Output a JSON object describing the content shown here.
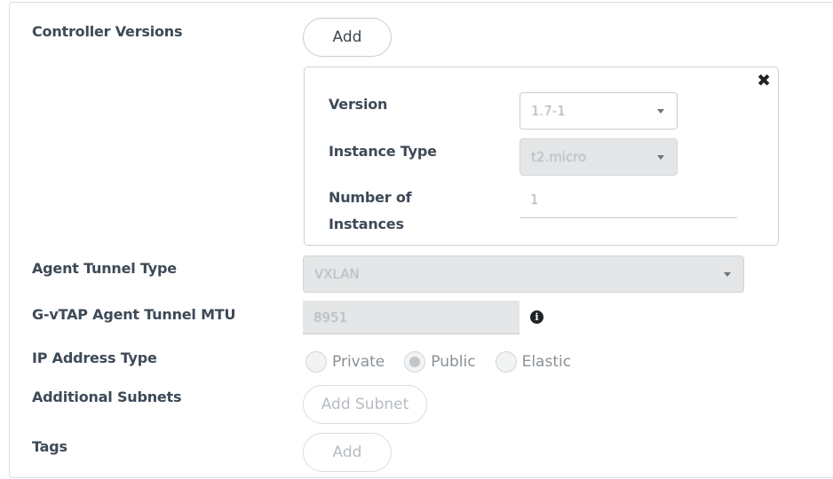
{
  "labels": {
    "controller_versions": "Controller Versions",
    "agent_tunnel_type": "Agent Tunnel Type",
    "gvtap_mtu": "G-vTAP Agent Tunnel MTU",
    "ip_address_type": "IP Address Type",
    "additional_subnets": "Additional Subnets",
    "tags": "Tags"
  },
  "controller": {
    "add_label": "Add",
    "close_glyph": "✖",
    "version_label": "Version",
    "version_value": "1.7-1",
    "instance_type_label": "Instance Type",
    "instance_type_value": "t2.micro",
    "num_instances_label_1": "Number of",
    "num_instances_label_2": "Instances",
    "num_instances_value": "1"
  },
  "agent_tunnel_type_value": "VXLAN",
  "mtu_value": "8951",
  "info_glyph": "i",
  "ip_address_options": [
    {
      "label": "Private",
      "checked": false
    },
    {
      "label": "Public",
      "checked": true
    },
    {
      "label": "Elastic",
      "checked": false
    }
  ],
  "add_subnet_label": "Add Subnet",
  "tags_add_label": "Add",
  "icons": {
    "close": "close-icon",
    "caret": "chevron-down-icon",
    "info": "info-icon"
  }
}
